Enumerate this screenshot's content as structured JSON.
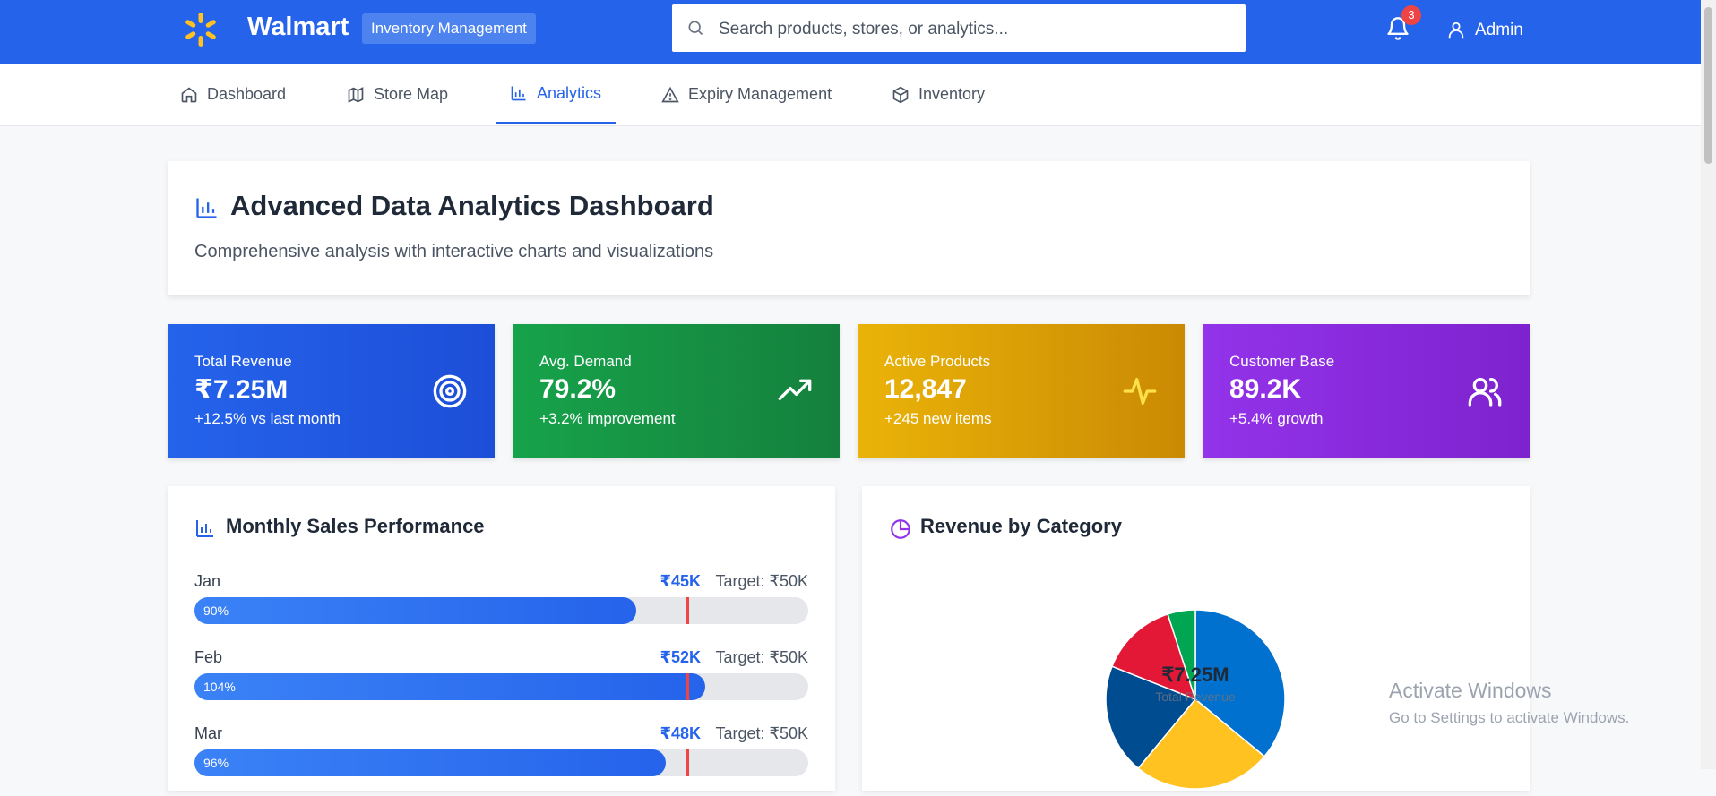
{
  "header": {
    "brand": "Walmart",
    "badge": "Inventory Management",
    "search_placeholder": "Search products, stores, or analytics...",
    "notification_count": "3",
    "user": "Admin",
    "brand_color": "#2563eb",
    "spark_color": "#ffc220"
  },
  "nav": {
    "tabs": [
      {
        "label": "Dashboard",
        "icon": "home-icon",
        "active": false
      },
      {
        "label": "Store Map",
        "icon": "map-icon",
        "active": false
      },
      {
        "label": "Analytics",
        "icon": "bar-chart-icon",
        "active": true
      },
      {
        "label": "Expiry Management",
        "icon": "warning-icon",
        "active": false
      },
      {
        "label": "Inventory",
        "icon": "box-icon",
        "active": false
      }
    ]
  },
  "page": {
    "title": "Advanced Data Analytics Dashboard",
    "subtitle": "Comprehensive analysis with interactive charts and visualizations"
  },
  "stats": [
    {
      "label": "Total Revenue",
      "value": "₹7.25M",
      "sub": "+12.5% vs last month",
      "icon": "target-icon"
    },
    {
      "label": "Avg. Demand",
      "value": "79.2%",
      "sub": "+3.2% improvement",
      "icon": "trending-up-icon"
    },
    {
      "label": "Active Products",
      "value": "12,847",
      "sub": "+245 new items",
      "icon": "activity-icon"
    },
    {
      "label": "Customer Base",
      "value": "89.2K",
      "sub": "+5.4% growth",
      "icon": "users-icon"
    }
  ],
  "sales_panel": {
    "title": "Monthly Sales Performance",
    "rows": [
      {
        "month": "Jan",
        "amount": "₹45K",
        "target": "Target: ₹50K",
        "pct_label": "90%",
        "pct": 90
      },
      {
        "month": "Feb",
        "amount": "₹52K",
        "target": "Target: ₹50K",
        "pct_label": "104%",
        "pct": 104
      },
      {
        "month": "Mar",
        "amount": "₹48K",
        "target": "Target: ₹50K",
        "pct_label": "96%",
        "pct": 96
      }
    ]
  },
  "category_panel": {
    "title": "Revenue by Category",
    "center_value": "₹7.25M",
    "center_label": "Total Revenue"
  },
  "chart_data": {
    "type": "pie",
    "title": "Revenue by Category",
    "values": [
      36,
      25,
      20,
      14,
      5
    ],
    "colors": [
      "#0071ce",
      "#ffc220",
      "#004c91",
      "#e31837",
      "#00a651"
    ]
  },
  "watermark": {
    "line1": "Activate Windows",
    "line2": "Go to Settings to activate Windows."
  }
}
